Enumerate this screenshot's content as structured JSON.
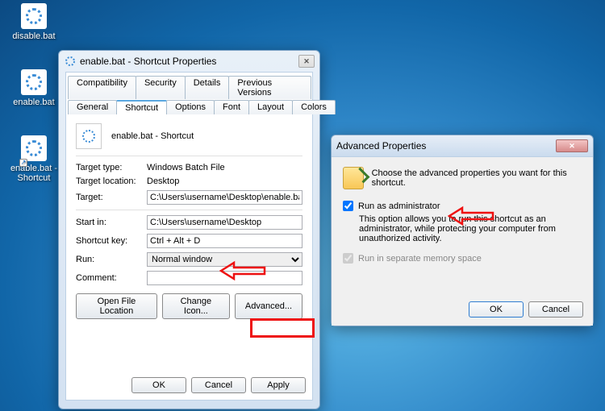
{
  "desktop": {
    "icons": [
      {
        "label": "disable.bat"
      },
      {
        "label": "enable.bat"
      },
      {
        "label": "enable.bat - Shortcut"
      }
    ]
  },
  "props": {
    "title": "enable.bat - Shortcut Properties",
    "tabs_top": [
      "Compatibility",
      "Security",
      "Details",
      "Previous Versions"
    ],
    "tabs_bottom": [
      "General",
      "Shortcut",
      "Options",
      "Font",
      "Layout",
      "Colors"
    ],
    "active_tab": "Shortcut",
    "file_name": "enable.bat - Shortcut",
    "target_type_label": "Target type:",
    "target_type": "Windows Batch File",
    "target_loc_label": "Target location:",
    "target_loc": "Desktop",
    "target_label": "Target:",
    "target": "C:\\Users\\username\\Desktop\\enable.bat",
    "start_in_label": "Start in:",
    "start_in": "C:\\Users\\username\\Desktop",
    "shortcut_key_label": "Shortcut key:",
    "shortcut_key": "Ctrl + Alt + D",
    "run_label": "Run:",
    "run": "Normal window",
    "comment_label": "Comment:",
    "comment": "",
    "btn_open": "Open File Location",
    "btn_icon": "Change Icon...",
    "btn_adv": "Advanced...",
    "btn_ok": "OK",
    "btn_cancel": "Cancel",
    "btn_apply": "Apply"
  },
  "adv": {
    "title": "Advanced Properties",
    "intro": "Choose the advanced properties you want for this shortcut.",
    "run_admin_label": "Run as administrator",
    "run_admin_checked": true,
    "explain": "This option allows you to run this shortcut as an administrator, while protecting your computer from unauthorized activity.",
    "sep_mem_label": "Run in separate memory space",
    "btn_ok": "OK",
    "btn_cancel": "Cancel"
  }
}
